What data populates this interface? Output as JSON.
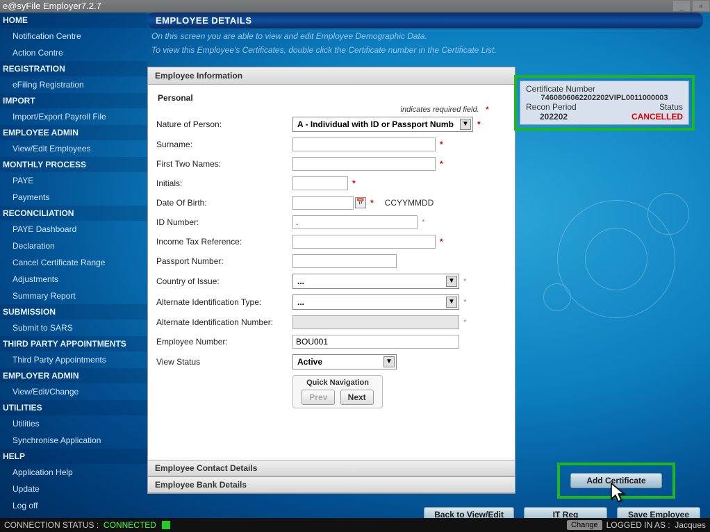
{
  "window": {
    "title": "e@syFile Employer7.2.7"
  },
  "sidebar": [
    {
      "type": "cat",
      "label": "HOME"
    },
    {
      "type": "item",
      "label": "Notification Centre"
    },
    {
      "type": "item",
      "label": "Action Centre"
    },
    {
      "type": "cat",
      "label": "REGISTRATION"
    },
    {
      "type": "item",
      "label": "eFiling Registration"
    },
    {
      "type": "cat",
      "label": "IMPORT"
    },
    {
      "type": "item",
      "label": "Import/Export Payroll File"
    },
    {
      "type": "cat",
      "label": "EMPLOYEE ADMIN"
    },
    {
      "type": "item",
      "label": "View/Edit Employees"
    },
    {
      "type": "cat",
      "label": "MONTHLY PROCESS"
    },
    {
      "type": "item",
      "label": "PAYE"
    },
    {
      "type": "item",
      "label": "Payments"
    },
    {
      "type": "cat",
      "label": "RECONCILIATION"
    },
    {
      "type": "item",
      "label": "PAYE Dashboard"
    },
    {
      "type": "item",
      "label": "Declaration"
    },
    {
      "type": "item",
      "label": "Cancel Certificate Range"
    },
    {
      "type": "item",
      "label": "Adjustments"
    },
    {
      "type": "item",
      "label": "Summary Report"
    },
    {
      "type": "cat",
      "label": "SUBMISSION"
    },
    {
      "type": "item",
      "label": "Submit to SARS"
    },
    {
      "type": "cat",
      "label": "THIRD PARTY APPOINTMENTS"
    },
    {
      "type": "item",
      "label": "Third Party Appointments"
    },
    {
      "type": "cat",
      "label": "EMPLOYER ADMIN"
    },
    {
      "type": "item",
      "label": "View/Edit/Change"
    },
    {
      "type": "cat",
      "label": "UTILITIES"
    },
    {
      "type": "item",
      "label": "Utilities"
    },
    {
      "type": "item",
      "label": "Synchronise Application"
    },
    {
      "type": "cat",
      "label": "HELP"
    },
    {
      "type": "item",
      "label": "Application Help"
    },
    {
      "type": "item",
      "label": "Update"
    },
    {
      "type": "item",
      "label": "Log off"
    }
  ],
  "panel": {
    "title": "EMPLOYEE DETAILS",
    "sub1": "On this screen you are able to view and edit Employee Demographic Data.",
    "sub2": "To view this Employee's Certificates, double click the Certificate number in the Certificate List."
  },
  "sections": {
    "info": "Employee Information",
    "personal": "Personal",
    "required_hint": "indicates required field.",
    "contact": "Employee Contact Details",
    "bank": "Employee Bank Details"
  },
  "form": {
    "nature_label": "Nature of Person:",
    "nature_value": "A - Individual with ID or Passport Numb",
    "surname_label": "Surname:",
    "firstnames_label": "First Two Names:",
    "initials_label": "Initials:",
    "dob_label": "Date Of Birth:",
    "dob_hint": "CCYYMMDD",
    "id_label": "ID Number:",
    "id_value": ".",
    "tax_label": "Income Tax Reference:",
    "passport_label": "Passport Number:",
    "country_label": "Country of Issue:",
    "country_value": "...",
    "altid_label": "Alternate Identification Type:",
    "altid_value": "...",
    "altnum_label": "Alternate Identification Number:",
    "empno_label": "Employee Number:",
    "empno_value": "BOU001",
    "view_label": "View Status",
    "view_value": "Active"
  },
  "quicknav": {
    "title": "Quick Navigation",
    "prev": "Prev",
    "next": "Next"
  },
  "cert": {
    "label": "Certificate Number",
    "number": "7460806062202202VIPL0011000003",
    "recon_label": "Recon Period",
    "recon_value": "202202",
    "status_label": "Status",
    "status_value": "CANCELLED"
  },
  "buttons": {
    "add_cert": "Add Certificate",
    "back": "Back to View/Edit",
    "itreg": "IT Reg",
    "save": "Save Employee"
  },
  "status": {
    "conn_label": "CONNECTION STATUS :",
    "conn_value": "CONNECTED",
    "change": "Change",
    "login_label": "LOGGED IN AS :",
    "login_user": "Jacques"
  }
}
